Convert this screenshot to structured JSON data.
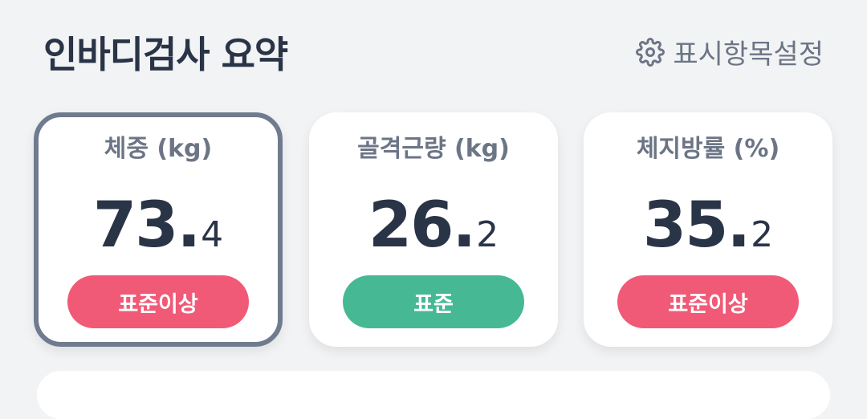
{
  "header": {
    "title": "인바디검사 요약",
    "settings_label": "표시항목설정",
    "settings_icon": "gear-icon"
  },
  "cards": [
    {
      "label": "체중 (kg)",
      "value_int": "73",
      "value_dot": ".",
      "value_dec": "4",
      "status": "표준이상",
      "status_color": "#f05a77",
      "selected": true
    },
    {
      "label": "골격근량 (kg)",
      "value_int": "26",
      "value_dot": ".",
      "value_dec": "2",
      "status": "표준",
      "status_color": "#46b994",
      "selected": false
    },
    {
      "label": "체지방률 (%)",
      "value_int": "35",
      "value_dot": ".",
      "value_dec": "2",
      "status": "표준이상",
      "status_color": "#f05a77",
      "selected": false
    }
  ],
  "colors": {
    "background": "#f2f3f5",
    "title_text": "#2a3447",
    "muted_text": "#6c7585",
    "selected_border": "#6f7b8e",
    "above_standard": "#f05a77",
    "standard": "#46b994"
  }
}
